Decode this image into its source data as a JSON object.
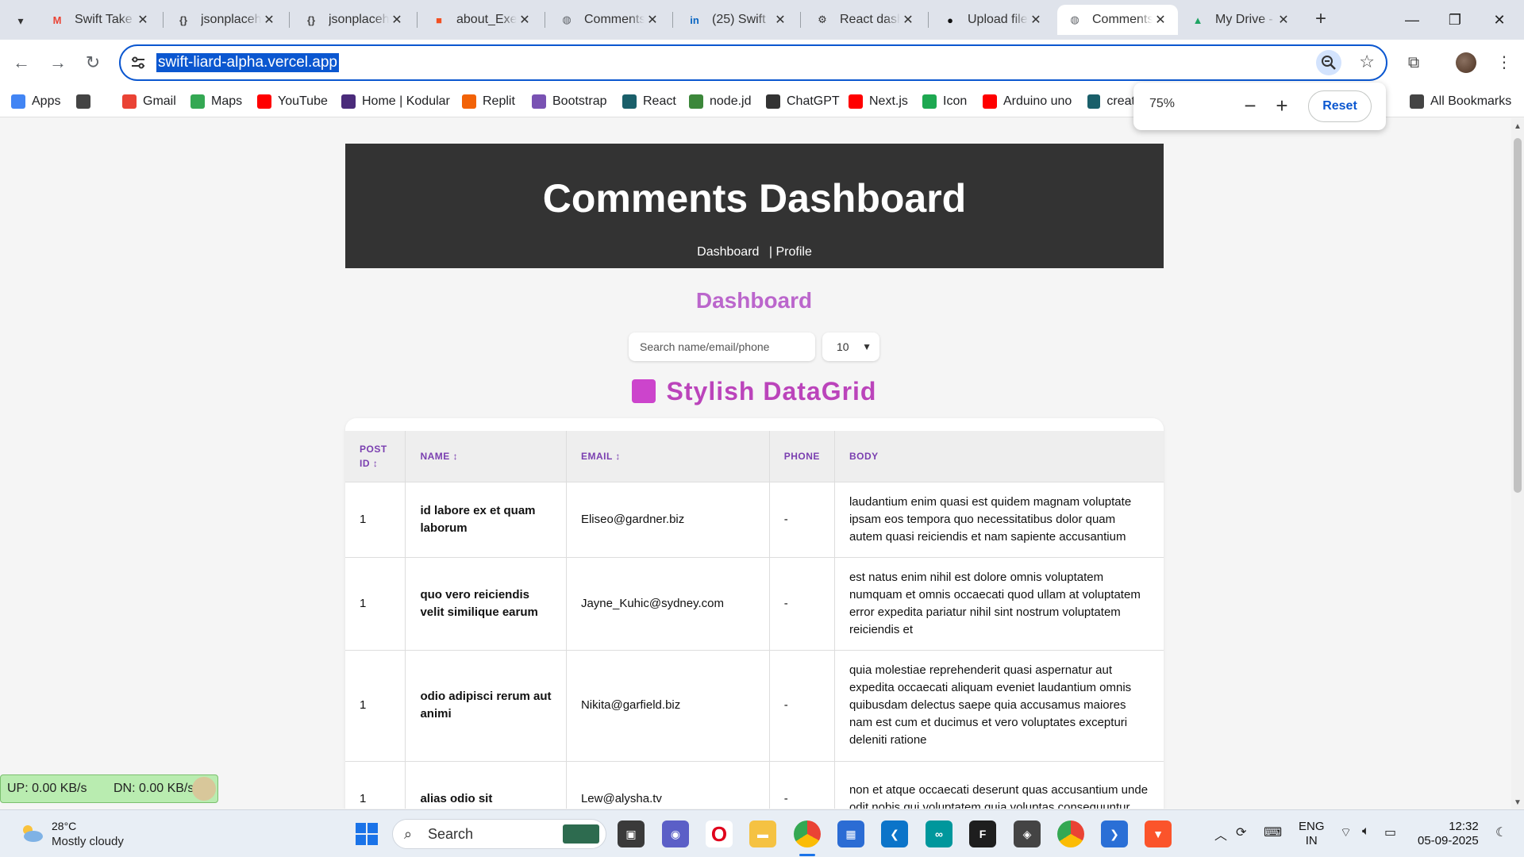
{
  "browser": {
    "tabs": [
      {
        "title": "Swift Take",
        "icon": "gmail-icon",
        "color": "#ea4335",
        "glyph": "M"
      },
      {
        "title": "jsonplaceh",
        "icon": "json-icon",
        "color": "#444444",
        "glyph": "{}"
      },
      {
        "title": "jsonplaceh",
        "icon": "json-icon",
        "color": "#444444",
        "glyph": "{}"
      },
      {
        "title": "about_Exec",
        "icon": "microsoft-icon",
        "color": "#f25022",
        "glyph": "■"
      },
      {
        "title": "Comments",
        "icon": "globe-icon",
        "color": "#5f6368",
        "glyph": "◍"
      },
      {
        "title": "(25) Swift",
        "icon": "linkedin-icon",
        "color": "#0a66c2",
        "glyph": "in"
      },
      {
        "title": "React dash",
        "icon": "openai-icon",
        "color": "#333333",
        "glyph": "⚙"
      },
      {
        "title": "Upload file",
        "icon": "github-icon",
        "color": "#111111",
        "glyph": "●"
      },
      {
        "title": "Comments",
        "icon": "globe-icon",
        "color": "#5f6368",
        "glyph": "◍",
        "active": true
      },
      {
        "title": "My Drive -",
        "icon": "drive-icon",
        "color": "#1fa463",
        "glyph": "▲"
      }
    ],
    "url": "swift-liard-alpha.vercel.app",
    "zoom": {
      "value": "75%",
      "reset_label": "Reset"
    },
    "bookmarks": [
      {
        "label": "Apps",
        "icon": "apps-grid-icon",
        "color": "#4285f4"
      },
      {
        "label": "",
        "icon": "grid-icon",
        "color": "#444444"
      },
      {
        "label": "Gmail",
        "icon": "gmail-icon",
        "color": "#ea4335"
      },
      {
        "label": "Maps",
        "icon": "maps-icon",
        "color": "#34a853"
      },
      {
        "label": "YouTube",
        "icon": "youtube-icon",
        "color": "#ff0000"
      },
      {
        "label": "Home | Kodular",
        "icon": "kodular-icon",
        "color": "#4a2b7a"
      },
      {
        "label": "Replit",
        "icon": "replit-icon",
        "color": "#f26207"
      },
      {
        "label": "Bootstrap",
        "icon": "bootstrap-icon",
        "color": "#7952b3"
      },
      {
        "label": "React",
        "icon": "react-icon",
        "color": "#1a5f6a"
      },
      {
        "label": "node.jd",
        "icon": "nodejs-icon",
        "color": "#3c873a"
      },
      {
        "label": "ChatGPT",
        "icon": "openai-icon",
        "color": "#333333"
      },
      {
        "label": "Next.js",
        "icon": "youtube-icon",
        "color": "#ff0000"
      },
      {
        "label": "Icon",
        "icon": "icon-app-icon",
        "color": "#1da851"
      },
      {
        "label": "Arduino uno",
        "icon": "youtube-icon",
        "color": "#ff0000"
      },
      {
        "label": "creat",
        "icon": "chip-icon",
        "color": "#1a5f6a"
      },
      {
        "label": "All Bookmarks",
        "icon": "folder-icon",
        "color": "#444444"
      }
    ]
  },
  "page": {
    "title": "Comments Dashboard",
    "nav": [
      "Dashboard",
      "| Profile"
    ],
    "section_title": "Dashboard",
    "search_placeholder": "Search name/email/phone",
    "page_size": "10",
    "grid_title": "Stylish DataGrid",
    "columns": [
      "POST ID ↕",
      "NAME ↕",
      "EMAIL ↕",
      "PHONE",
      "BODY"
    ],
    "rows": [
      {
        "post_id": "1",
        "name": "id labore ex et quam laborum",
        "email": "Eliseo@gardner.biz",
        "phone": "-",
        "body": "laudantium enim quasi est quidem magnam voluptate ipsam eos tempora quo necessitatibus dolor quam autem quasi reiciendis et nam sapiente accusantium"
      },
      {
        "post_id": "1",
        "name": "quo vero reiciendis velit similique earum",
        "email": "Jayne_Kuhic@sydney.com",
        "phone": "-",
        "body": "est natus enim nihil est dolore omnis voluptatem numquam et omnis occaecati quod ullam at voluptatem error expedita pariatur nihil sint nostrum voluptatem reiciendis et"
      },
      {
        "post_id": "1",
        "name": "odio adipisci rerum aut animi",
        "email": "Nikita@garfield.biz",
        "phone": "-",
        "body": "quia molestiae reprehenderit quasi aspernatur aut expedita occaecati aliquam eveniet laudantium omnis quibusdam delectus saepe quia accusamus maiores nam est cum et ducimus et vero voluptates excepturi deleniti ratione"
      },
      {
        "post_id": "1",
        "name": "alias odio sit",
        "email": "Lew@alysha.tv",
        "phone": "-",
        "body": "non et atque occaecati deserunt quas accusantium unde odit nobis qui voluptatem quia voluptas consequuntur"
      }
    ]
  },
  "net_meter": {
    "up": "UP: 0.00 KB/s",
    "down": "DN: 0.00 KB/s"
  },
  "taskbar": {
    "weather_temp": "28°C",
    "weather_desc": "Mostly cloudy",
    "search_label": "Search",
    "lang_top": "ENG",
    "lang_bottom": "IN",
    "time": "12:32",
    "date": "05-09-2025"
  }
}
